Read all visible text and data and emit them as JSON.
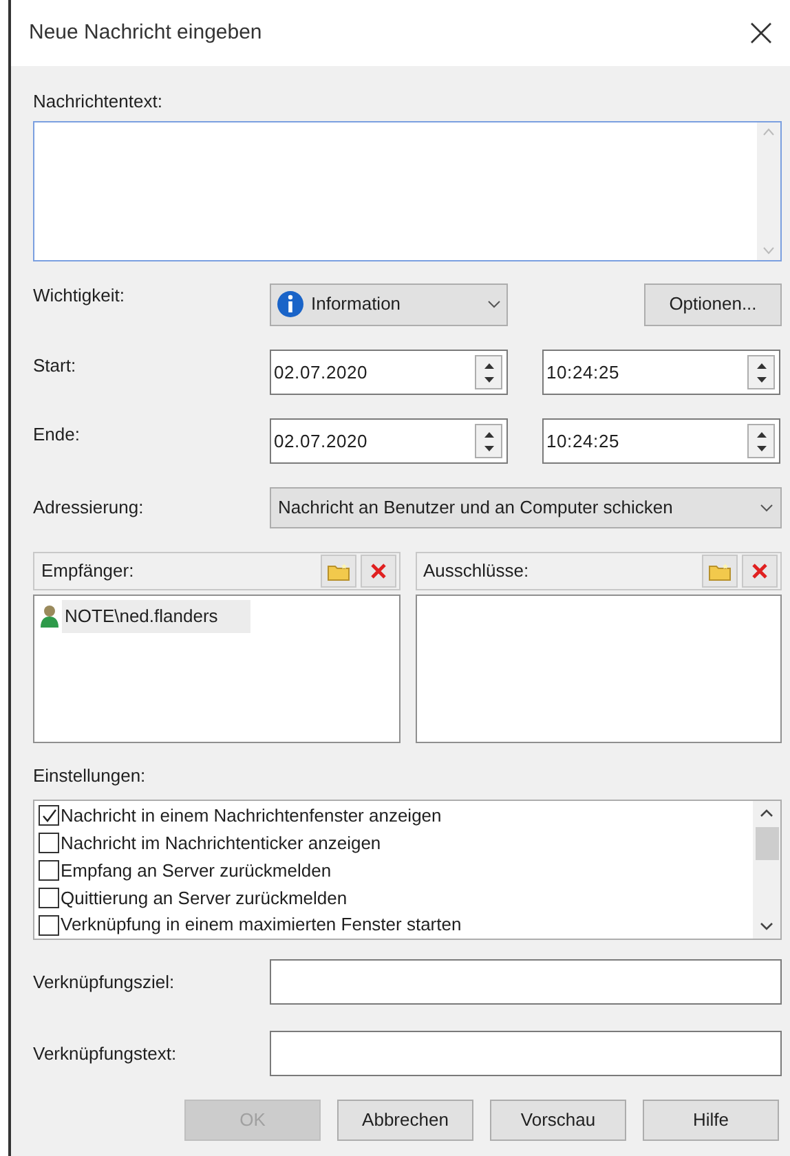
{
  "window": {
    "title": "Neue Nachricht eingeben"
  },
  "message": {
    "label": "Nachrichtentext:"
  },
  "importance": {
    "label": "Wichtigkeit:",
    "value": "Information",
    "options_button": "Optionen..."
  },
  "start": {
    "label": "Start:",
    "date": "02.07.2020",
    "time": "10:24:25"
  },
  "end": {
    "label": "Ende:",
    "date": "02.07.2020",
    "time": "10:24:25"
  },
  "addressing": {
    "label": "Adressierung:",
    "value": "Nachricht an Benutzer und an Computer schicken"
  },
  "recipients": {
    "header": "Empfänger:",
    "items": [
      {
        "text": "NOTE\\ned.flanders",
        "selected": true
      }
    ]
  },
  "exclusions": {
    "header": "Ausschlüsse:"
  },
  "settings": {
    "label": "Einstellungen:",
    "items": [
      {
        "label": "Nachricht in einem Nachrichtenfenster anzeigen",
        "checked": true
      },
      {
        "label": "Nachricht im Nachrichtenticker anzeigen",
        "checked": false
      },
      {
        "label": "Empfang an Server zurückmelden",
        "checked": false
      },
      {
        "label": "Quittierung an Server zurückmelden",
        "checked": false
      },
      {
        "label": "Verknüpfung in einem maximierten Fenster starten",
        "checked": false
      }
    ]
  },
  "link_target": {
    "label": "Verknüpfungsziel:"
  },
  "link_text": {
    "label": "Verknüpfungstext:"
  },
  "buttons": [
    {
      "label": "OK",
      "disabled": true
    },
    {
      "label": "Abbrechen",
      "disabled": false
    },
    {
      "label": "Vorschau",
      "disabled": false
    },
    {
      "label": "Hilfe",
      "disabled": false
    }
  ]
}
